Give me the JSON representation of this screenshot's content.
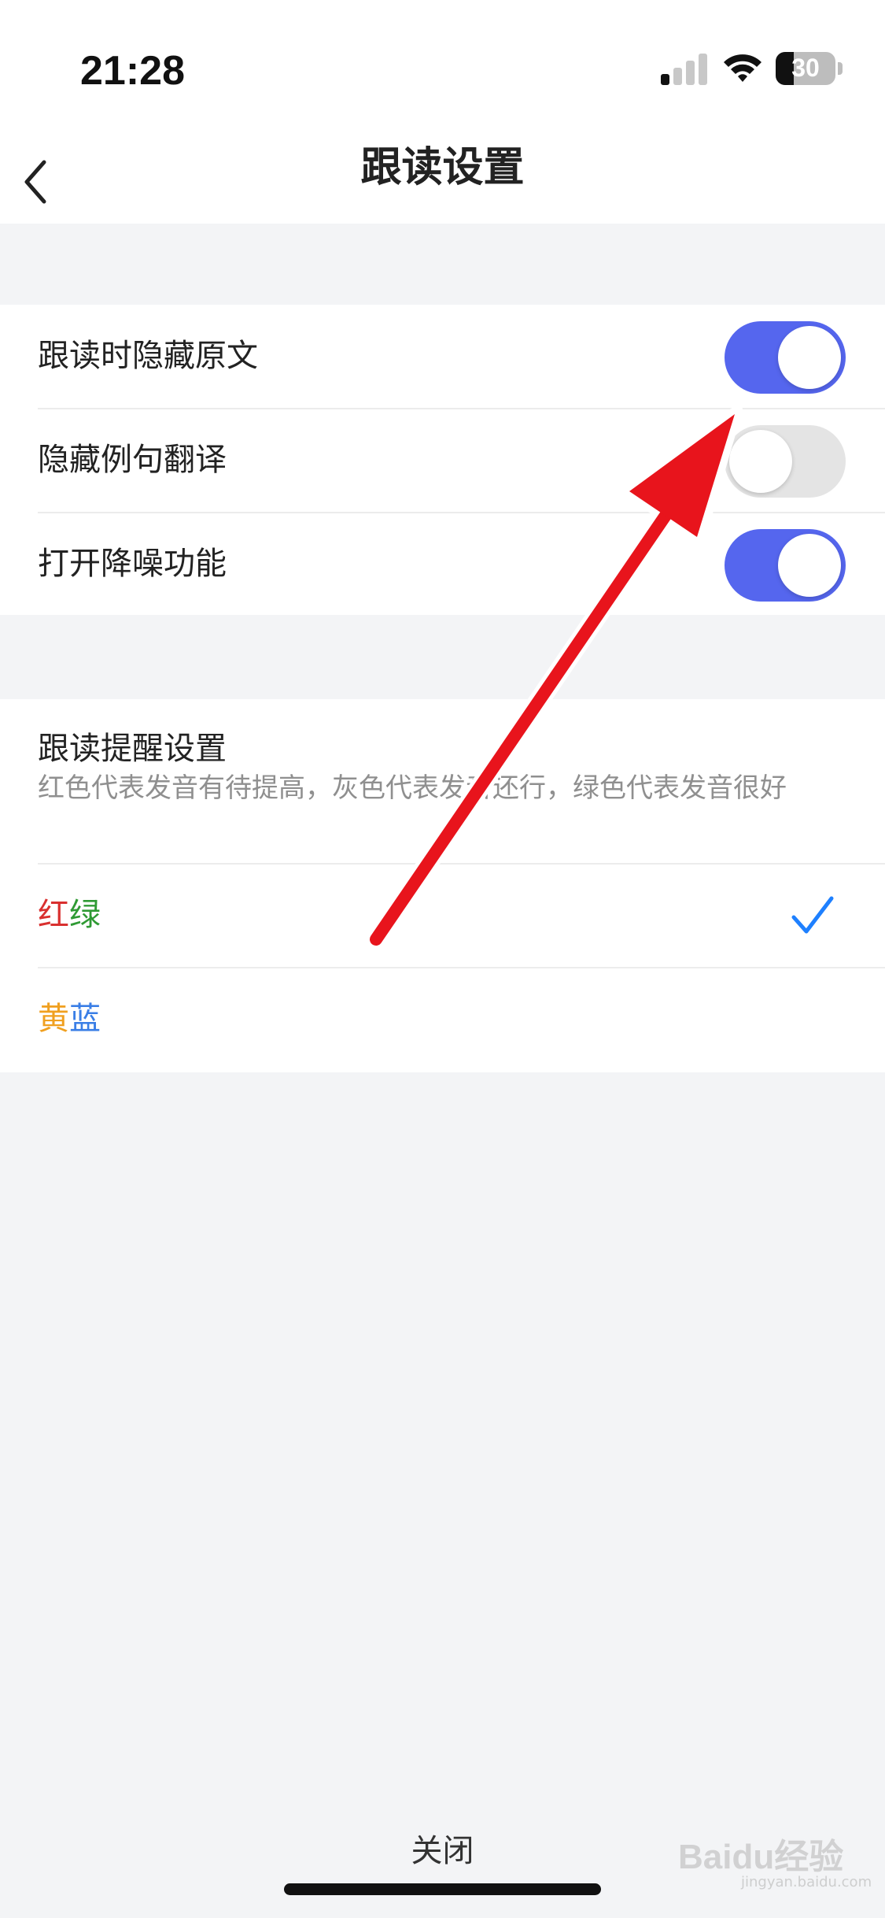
{
  "status_bar": {
    "time": "21:28",
    "battery_level": "30",
    "icons": [
      "cellular-signal-icon",
      "wifi-icon",
      "battery-icon"
    ]
  },
  "nav": {
    "title": "跟读设置",
    "back_icon": "chevron-left-icon"
  },
  "toggles": [
    {
      "label": "跟读时隐藏原文",
      "on": true
    },
    {
      "label": "隐藏例句翻译",
      "on": false
    },
    {
      "label": "打开降噪功能",
      "on": true
    }
  ],
  "reminder": {
    "title": "跟读提醒设置",
    "description": "红色代表发音有待提高，灰色代表发音还行，绿色代表发音很好",
    "options": [
      {
        "part1": "红",
        "part2": "绿",
        "color1": "#d9302f",
        "color2": "#2f9a34",
        "selected": true
      },
      {
        "part1": "黄",
        "part2": "蓝",
        "color1": "#f0a020",
        "color2": "#3a7ee6",
        "selected": false
      }
    ]
  },
  "footer": {
    "close_label": "关闭"
  },
  "watermark": {
    "brand": "Baidu经验",
    "url": "jingyan.baidu.com"
  },
  "colors": {
    "accent": "#5566ee",
    "check": "#1e80ff",
    "annotation_arrow": "#e8141c"
  }
}
